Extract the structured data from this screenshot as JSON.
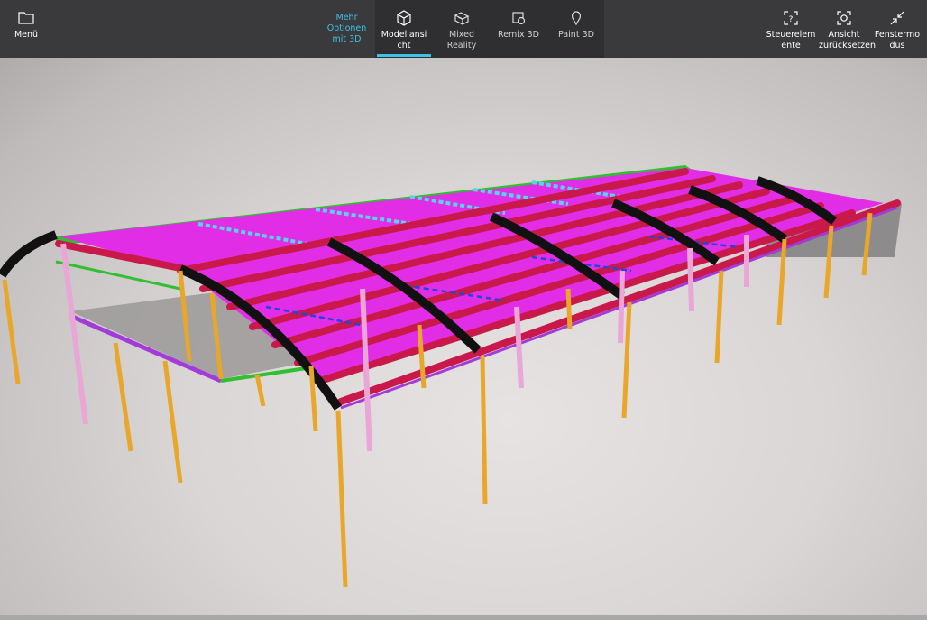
{
  "toolbar": {
    "menu_label": "Menü",
    "more_options_label": "Mehr Optionen mit 3D",
    "tabs": [
      {
        "label": "Modellansicht",
        "active": true
      },
      {
        "label": "Mixed Reality",
        "active": false
      },
      {
        "label": "Remix 3D",
        "active": false
      },
      {
        "label": "Paint 3D",
        "active": false
      }
    ],
    "right_buttons": [
      {
        "label": "Steuerelemente"
      },
      {
        "label": "Ansicht zurücksetzen"
      },
      {
        "label": "Fenstermodus"
      }
    ]
  },
  "icons": {
    "menu": "folder-icon",
    "model_view": "cube-icon",
    "mixed_reality": "mixed-reality-icon",
    "remix": "remix-3d-icon",
    "paint": "paint-3d-icon",
    "controls": "controls-icon",
    "reset_view": "reset-view-icon",
    "window_mode": "collapse-arrows-icon"
  },
  "colors": {
    "accent": "#3fc1e8",
    "toolbar_bg": "#3a3a3c",
    "tab_group_bg": "#2f2f31",
    "model_columns": "#e8a72a",
    "model_arches": "#111111",
    "model_purlins": "#c8194a",
    "model_roof_panels": "#e12ee6",
    "model_edge_beams": "#2fbf2f"
  }
}
